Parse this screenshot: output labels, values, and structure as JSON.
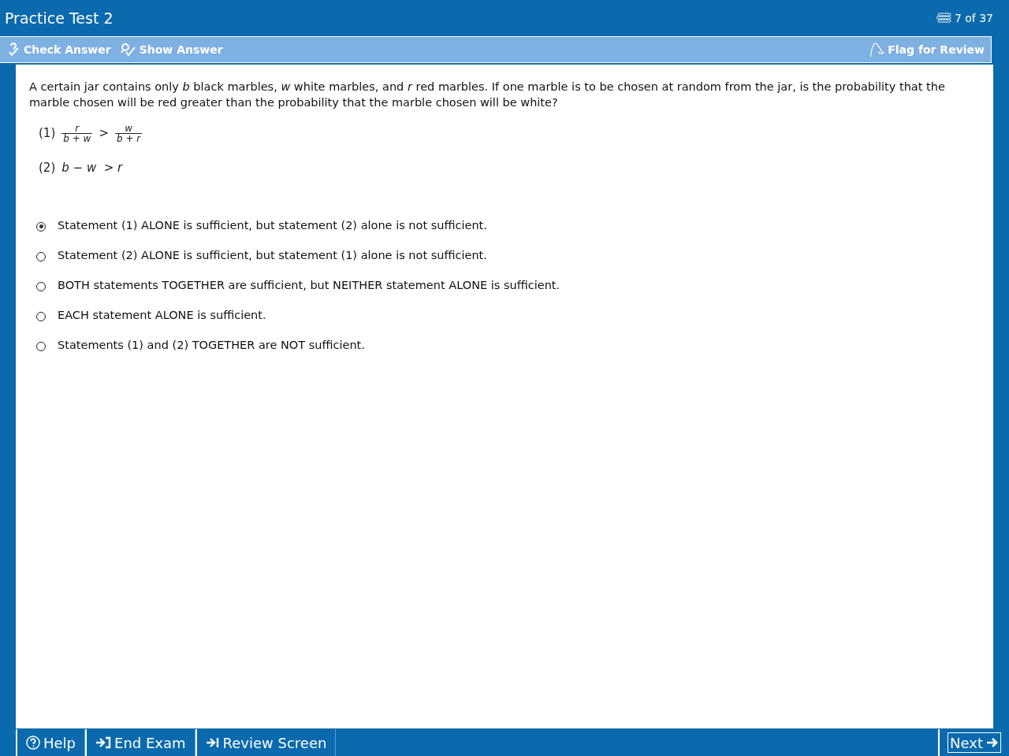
{
  "window": {
    "title": "Practice Test 2",
    "progress": "7 of 37"
  },
  "toolbar": {
    "left": [
      {
        "kind": "check",
        "label": "Check Answer"
      },
      {
        "kind": "show",
        "label": "Show Answer"
      }
    ],
    "flag": {
      "label": "Flag for Review"
    }
  },
  "question": {
    "text": "A certain jar contains only *b* black marbles, *w* white marbles, and *r* red marbles.  If one marble is to be chosen at random from the jar, is the probability that the marble chosen will be red greater than the probability that the marble chosen will be white?",
    "statements": [
      {
        "kind": "fraction",
        "label": "(1)",
        "left": {
          "numerator": "r",
          "denominator": "b + w"
        },
        "operator": ">",
        "right": {
          "numerator": "w",
          "denominator": "b + r"
        }
      },
      {
        "kind": "inline",
        "label": "(2)",
        "expression": "b − w  > r"
      }
    ]
  },
  "choices": [
    {
      "text": "Statement (1) ALONE is sufficient, but statement (2) alone is not sufficient.",
      "selected": true
    },
    {
      "text": "Statement (2) ALONE is sufficient, but statement (1) alone is not sufficient.",
      "selected": false
    },
    {
      "text": "BOTH statements TOGETHER are sufficient, but NEITHER statement ALONE is sufficient.",
      "selected": false
    },
    {
      "text": "EACH statement ALONE is sufficient.",
      "selected": false
    },
    {
      "text": "Statements (1) and (2) TOGETHER are NOT sufficient.",
      "selected": false
    }
  ],
  "footer": {
    "left": [
      {
        "kind": "help",
        "label": "Help"
      },
      {
        "kind": "end",
        "label": "End Exam"
      },
      {
        "kind": "review",
        "label": "Review Screen"
      }
    ],
    "next": {
      "label": "Next"
    }
  }
}
